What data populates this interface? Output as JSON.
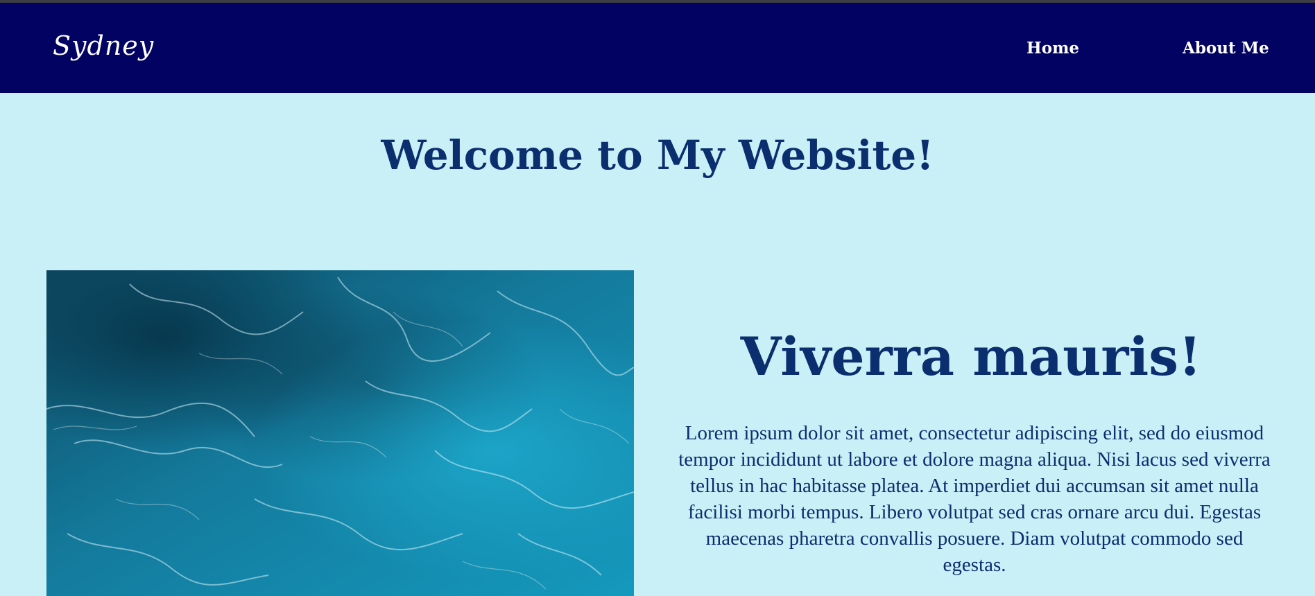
{
  "header": {
    "brand": "Sydney",
    "nav": [
      {
        "label": "Home"
      },
      {
        "label": "About Me"
      }
    ]
  },
  "main": {
    "welcome_heading": "Welcome to My Website!",
    "section": {
      "title": "Viverra mauris!",
      "body": "Lorem ipsum dolor sit amet, consectetur adipiscing elit, sed do eiusmod tempor incididunt ut labore et dolore magna aliqua. Nisi lacus sed viverra tellus in hac habitasse platea. At imperdiet dui accumsan sit amet nulla facilisi morbi tempus. Libero volutpat sed cras ornare arcu dui. Egestas maecenas pharetra convallis posuere. Diam volutpat commodo sed egestas."
    }
  },
  "colors": {
    "navbar": "#020262",
    "page_background": "#c9f0f6",
    "heading_text": "#0b2e6f"
  }
}
